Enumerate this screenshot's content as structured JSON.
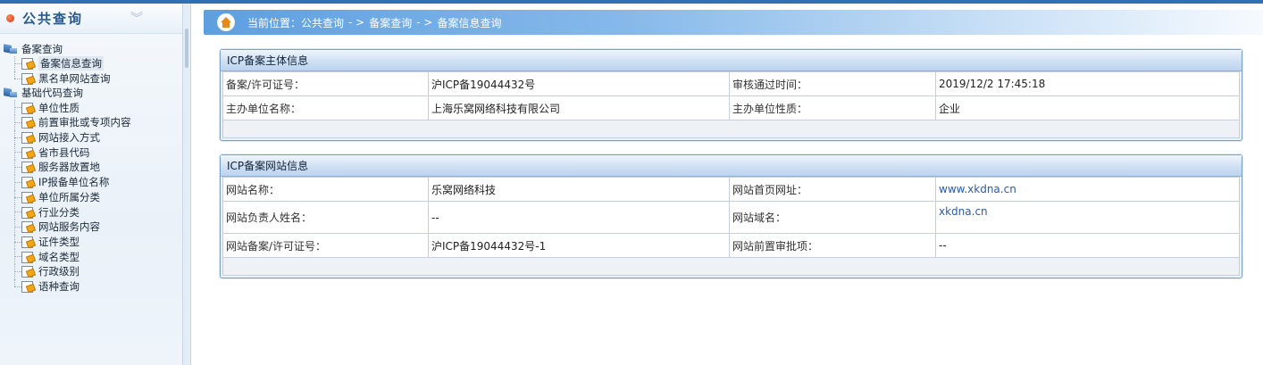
{
  "sidebar": {
    "title": "公共查询",
    "groups": [
      {
        "label": "备案查询",
        "items": [
          "备案信息查询",
          "黑名单网站查询"
        ]
      },
      {
        "label": "基础代码查询",
        "items": [
          "单位性质",
          "前置审批或专项内容",
          "网站接入方式",
          "省市县代码",
          "服务器放置地",
          "IP报备单位名称",
          "单位所属分类",
          "行业分类",
          "网站服务内容",
          "证件类型",
          "域名类型",
          "行政级别",
          "语种查询"
        ]
      }
    ],
    "active_item": "备案信息查询"
  },
  "breadcrumb": {
    "prefix": "当前位置：公共查询",
    "sep1": "- >",
    "part2": "备案查询",
    "sep2": "- >",
    "part3": "备案信息查询"
  },
  "subject_panel": {
    "title": "ICP备案主体信息",
    "rows": [
      [
        "备案/许可证号：",
        "沪ICP备19044432号",
        "审核通过时间：",
        "2019/12/2 17:45:18"
      ],
      [
        "主办单位名称：",
        "上海乐窝网络科技有限公司",
        "主办单位性质：",
        "企业"
      ]
    ]
  },
  "website_panel": {
    "title": "ICP备案网站信息",
    "rows": [
      [
        "网站名称：",
        "乐窝网络科技",
        "网站首页网址：",
        "www.xkdna.cn"
      ],
      [
        "网站负责人姓名：",
        "--",
        "网站域名：",
        "xkdna.cn"
      ],
      [
        "网站备案/许可证号：",
        "沪ICP备19044432号-1",
        "网站前置审批项：",
        "--"
      ]
    ]
  },
  "colors": {
    "accent": "#2f6fb4",
    "link": "#2a5aa5",
    "panel_border": "#7aa0c8"
  }
}
